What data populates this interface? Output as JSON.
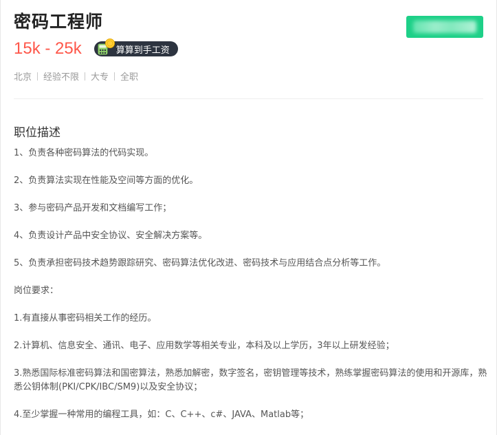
{
  "job": {
    "title": "密码工程师",
    "salary": "15k - 25k",
    "badge_label": "算算到手工资",
    "meta": [
      "北京",
      "经验不限",
      "大专",
      "全职"
    ]
  },
  "section": {
    "title": "职位描述"
  },
  "description": [
    "1、负责各种密码算法的代码实现。",
    "2、负责算法实现在性能及空间等方面的优化。",
    "3、参与密码产品开发和文档编写工作；",
    "4、负责设计产品中安全协议、安全解决方案等。",
    "5、负责承担密码技术趋势跟踪研究、密码算法优化改进、密码技术与应用结合点分析等工作。",
    "岗位要求：",
    "1.有直接从事密码相关工作的经历。",
    "2.计算机、信息安全、通讯、电子、应用数学等相关专业，本科及以上学历，3年以上研发经验；",
    "3.熟悉国际标准密码算法和国密算法，熟悉加解密，数字签名，密钥管理等技术，熟练掌握密码算法的使用和开源库，熟悉公钥体制(PKI/CPK/IBC/SM9)以及安全协议；",
    "4.至少掌握一种常用的编程工具，如：C、C++、c#、JAVA、Matlab等；"
  ],
  "colors": {
    "salary": "#fe574a",
    "badge_bg": "#2d3440",
    "action_button": "#1ed088"
  },
  "icons": {
    "badge": "calculator-coin-icon"
  }
}
